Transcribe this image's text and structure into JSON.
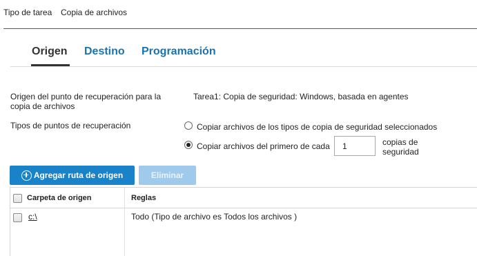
{
  "breadcrumb": {
    "task_type_label": "Tipo de tarea",
    "task_type_value": "Copia de archivos"
  },
  "tabs": [
    {
      "label": "Origen",
      "active": true
    },
    {
      "label": "Destino",
      "active": false
    },
    {
      "label": "Programación",
      "active": false
    }
  ],
  "form": {
    "recovery_source_label_line1": "Origen del punto de recuperación para la",
    "recovery_source_label_line2": "copia de archivos",
    "recovery_source_value": "Tarea1: Copia de seguridad: Windows, basada en agentes",
    "recovery_types_label": "Tipos de puntos de recuperación",
    "option_selected_types": "Copiar archivos de los tipos de copia de seguridad seleccionados",
    "option_first_each": "Copiar archivos del primero de cada",
    "first_each_count": "1",
    "backups_suffix_line1": "copias de",
    "backups_suffix_line2": "seguridad",
    "selected_option": "first_each"
  },
  "toolbar": {
    "add_source_label": "Agregar ruta de origen",
    "delete_label": "Eliminar",
    "primary_color": "#1a82c8",
    "disabled_color": "#9fcaec"
  },
  "table": {
    "columns": [
      "Carpeta de origen",
      "Reglas"
    ],
    "rows": [
      {
        "folder": "c:\\",
        "rules": "Todo (Tipo de archivo es Todos los archivos )"
      }
    ]
  },
  "colors": {
    "tab_inactive": "#1a73ad",
    "tab_active": "#333333"
  }
}
